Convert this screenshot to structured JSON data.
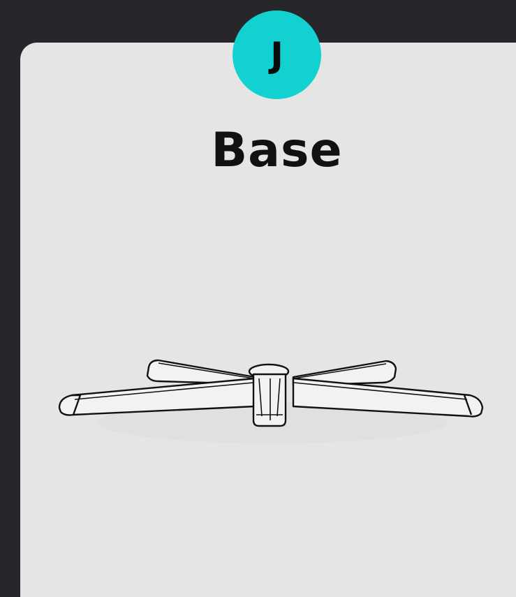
{
  "step": {
    "letter": "J",
    "badge_color": "#13d1d1",
    "title": "Base",
    "illustration_icon": "chair-base-icon"
  },
  "colors": {
    "background": "#26262b",
    "card": "#e5e5e5",
    "text": "#111111"
  }
}
